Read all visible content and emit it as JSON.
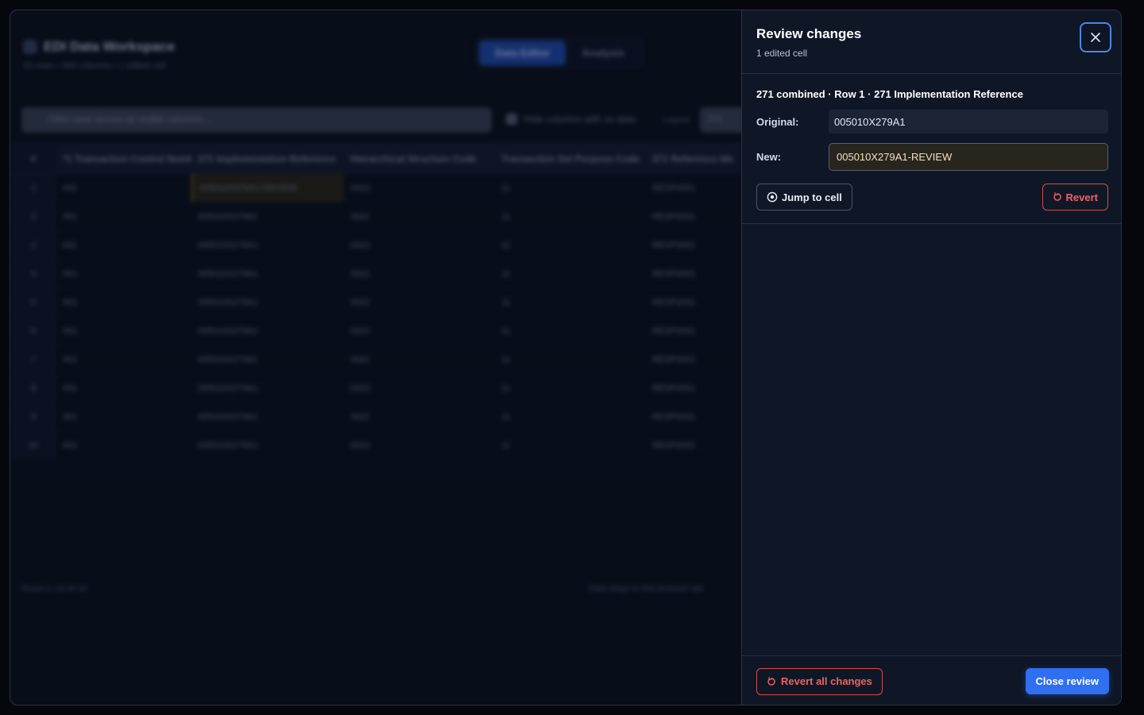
{
  "workspace": {
    "title": "EDI Data Workspace",
    "subtitle": "10 rows • 369 columns • 1 edited cell",
    "tabs": [
      {
        "label": "Data Editor"
      },
      {
        "label": "Analysis"
      }
    ],
    "filter_placeholder": "Filter rows across all visible columns...",
    "hide_empty_label": "Hide columns with no data",
    "layout_label": "Layout",
    "layout_value": "271",
    "columns": [
      "#",
      "*1 Transaction Control Numb",
      "271 Implementation Reference",
      "Hierarchical Structure Code",
      "Transaction Set Purpose Code",
      "271 Reference Ide"
    ],
    "rows": [
      [
        "1",
        "#01",
        "005010X279A1-REVIEW",
        "0022",
        "11",
        "RESP0001"
      ],
      [
        "2",
        "#01",
        "005010X279A1",
        "0022",
        "11",
        "RESP0001"
      ],
      [
        "3",
        "#01",
        "005010X279A1",
        "0022",
        "11",
        "RESP0001"
      ],
      [
        "4",
        "#01",
        "005010X279A1",
        "0022",
        "11",
        "RESP0001"
      ],
      [
        "5",
        "#01",
        "005010X279A1",
        "0022",
        "11",
        "RESP0001"
      ],
      [
        "6",
        "#01",
        "005010X279A1",
        "0022",
        "11",
        "RESP0001"
      ],
      [
        "7",
        "#01",
        "005010X279A1",
        "0022",
        "11",
        "RESP0001"
      ],
      [
        "8",
        "#01",
        "005010X279A1",
        "0022",
        "11",
        "RESP0001"
      ],
      [
        "9",
        "#01",
        "005010X279A1",
        "0022",
        "11",
        "RESP0001"
      ],
      [
        "10",
        "#01",
        "005010X279A1",
        "0022",
        "11",
        "RESP0001"
      ]
    ],
    "footer_rows": "Rows 1–10 of 10",
    "footer_note": "Data stays in this browser tab"
  },
  "review": {
    "title": "Review changes",
    "subtitle": "1 edited cell",
    "close_icon": "close-icon",
    "change": {
      "heading": "271 combined · Row 1 · 271 Implementation Reference",
      "original_label": "Original:",
      "original_value": "005010X279A1",
      "new_label": "New:",
      "new_value": "005010X279A1-REVIEW",
      "jump_label": "Jump to cell",
      "revert_label": "Revert"
    },
    "footer": {
      "revert_all_label": "Revert all changes",
      "close_label": "Close review"
    },
    "colors": {
      "primary": "#2f6ff0",
      "danger": "#f06262",
      "panel_bg": "#0f1727"
    }
  }
}
